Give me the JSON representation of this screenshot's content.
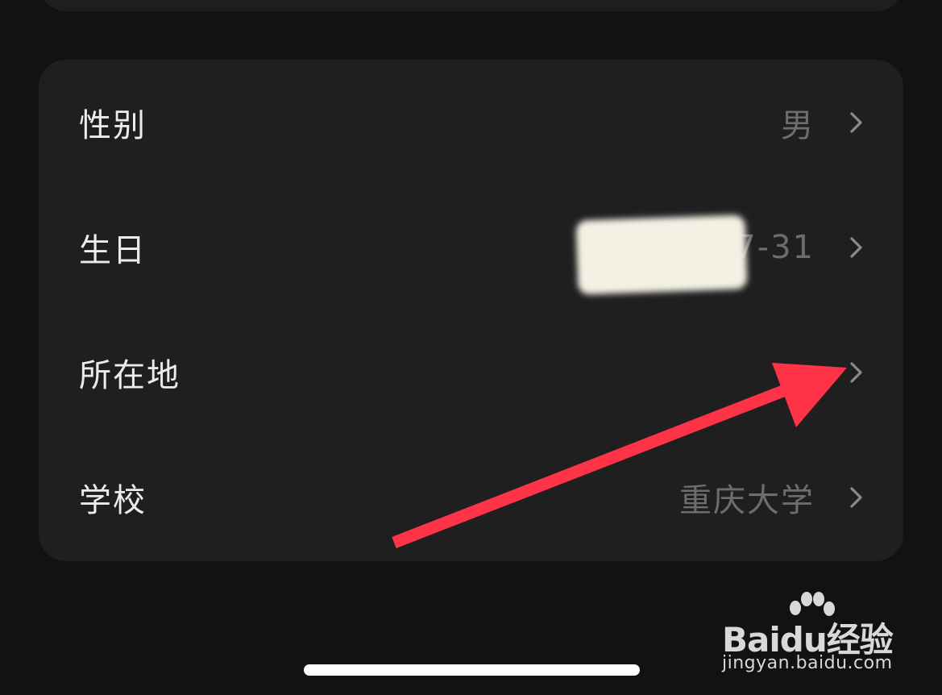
{
  "profile": {
    "rows": [
      {
        "key": "gender",
        "label": "性别",
        "value": "男"
      },
      {
        "key": "birthday",
        "label": "生日",
        "value": "1985-07-31"
      },
      {
        "key": "location",
        "label": "所在地",
        "value": ""
      },
      {
        "key": "school",
        "label": "学校",
        "value": "重庆大学"
      }
    ],
    "chevron_icon": "chevron-right-icon"
  },
  "annotation": {
    "arrow_color": "#ff3347"
  },
  "watermark": {
    "logo_text": "Baidu经验",
    "url": "jingyan.baidu.com"
  },
  "colors": {
    "background": "#121212",
    "card": "#1f1f20",
    "label": "#ececec",
    "value": "#6d6d6d",
    "chevron": "#8a8a8a"
  }
}
